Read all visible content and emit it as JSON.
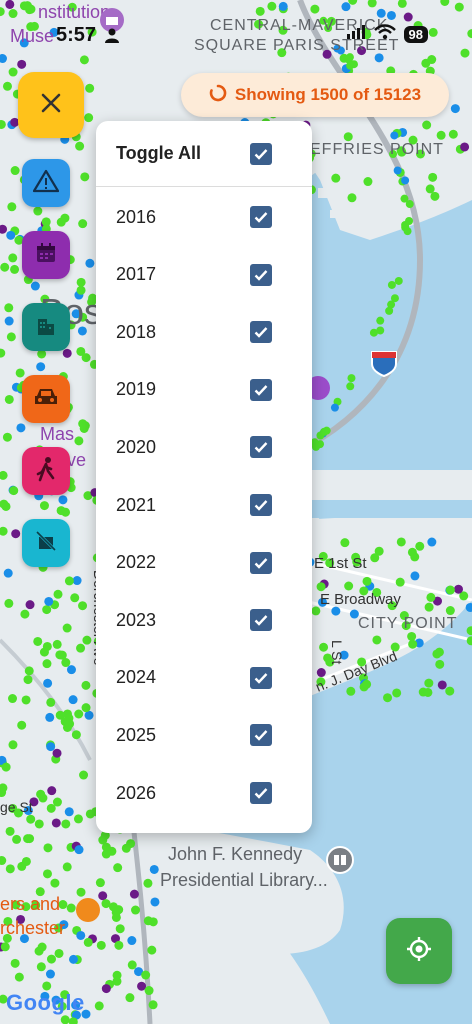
{
  "status_bar": {
    "time": "5:57",
    "battery": "98"
  },
  "banner": {
    "text": "Showing 1500 of 15123",
    "color": "#e45a12"
  },
  "fabs": [
    {
      "name": "close",
      "color": "#ffc21a"
    },
    {
      "name": "hazard",
      "color": "#2d97e8"
    },
    {
      "name": "calendar",
      "color": "#8e2dae"
    },
    {
      "name": "buildings",
      "color": "#168a80"
    },
    {
      "name": "car",
      "color": "#f06718"
    },
    {
      "name": "pedestrian",
      "color": "#e3286b"
    },
    {
      "name": "no-bike",
      "color": "#19b6d0"
    }
  ],
  "year_filter": {
    "toggle_all_label": "Toggle All",
    "years": [
      "2016",
      "2017",
      "2018",
      "2019",
      "2020",
      "2021",
      "2022",
      "2023",
      "2024",
      "2025",
      "2026"
    ],
    "all_checked": true
  },
  "map_labels": {
    "institution": "nstitution",
    "museum": "Muse",
    "central": "CENTRAL-MAVERICK",
    "square": "SQUARE PARIS STREET",
    "jeffries": "EFFRIES POINT",
    "e1st": "E 1st St",
    "broadway": "E Broadway",
    "city_point": "CITY POINT",
    "jday": "n. J. Day Blvd",
    "jfk1": "John F. Kennedy",
    "jfk2": "Presidential Library...",
    "dorchester_ave": "Dorchester Ave",
    "lst": "L St",
    "bos": "Bos",
    "mas": "Mas",
    "unive": "Unive",
    "ers_and": "ers and",
    "chester": "rchester",
    "ge_st": "ge St",
    "google": "Google"
  },
  "colors": {
    "water": "#a9d3ec",
    "land": "#e7ecef",
    "point_green": "#4fe02a",
    "point_blue": "#1a8ee8",
    "point_purple": "#6b1a87",
    "checkbox": "#3b5f8c",
    "locate": "#43a84a"
  }
}
